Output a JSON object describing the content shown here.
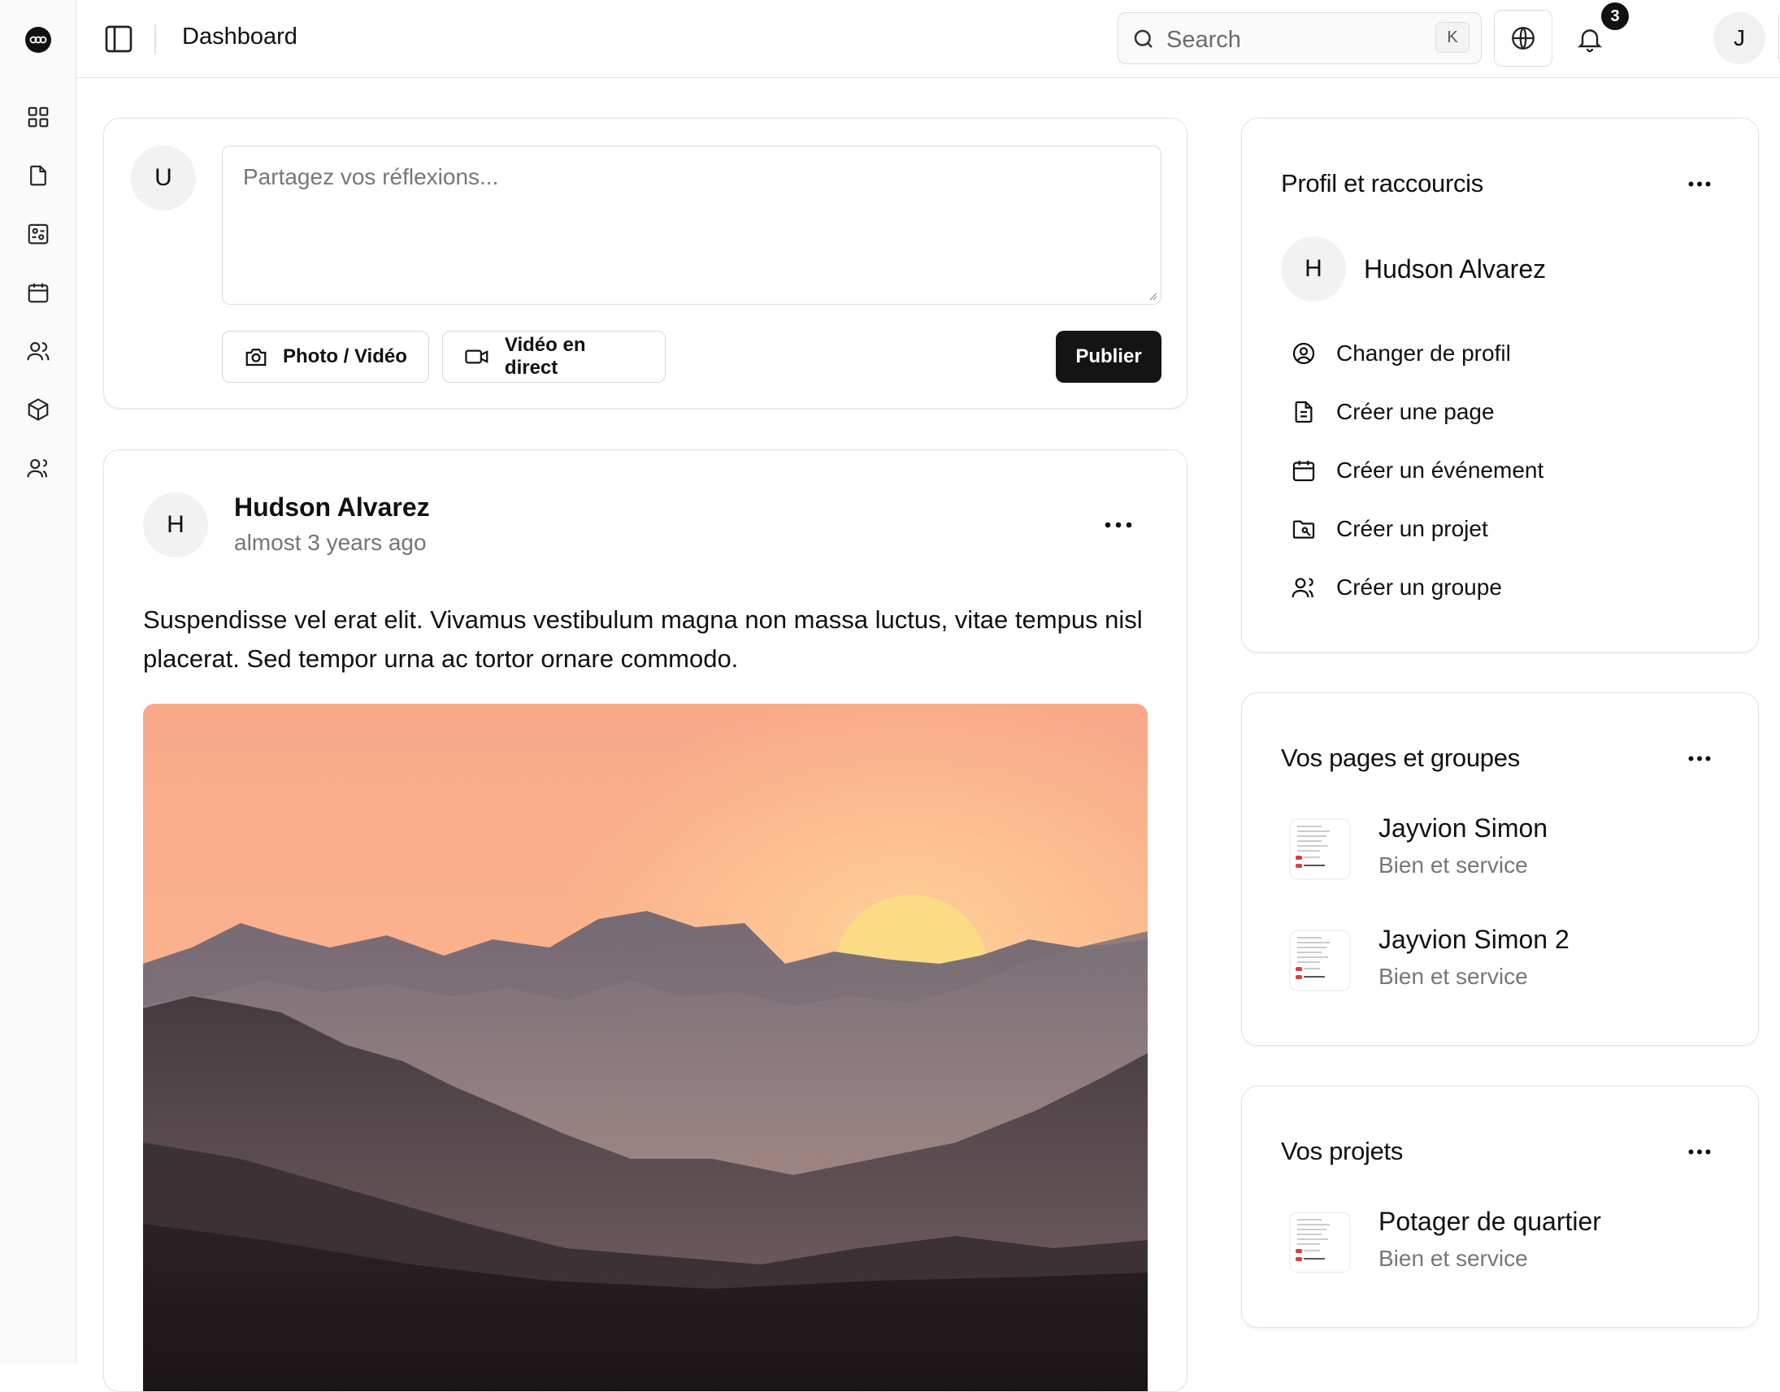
{
  "topbar": {
    "title": "Dashboard",
    "search_placeholder": "Search",
    "search_shortcut": "K",
    "notification_count": "3",
    "user_initial": "J"
  },
  "sidebar": {
    "items": [
      {
        "icon": "grid-icon"
      },
      {
        "icon": "file-icon"
      },
      {
        "icon": "kanban-icon"
      },
      {
        "icon": "calendar-icon"
      },
      {
        "icon": "users-icon"
      },
      {
        "icon": "box-icon"
      },
      {
        "icon": "group-icon"
      }
    ]
  },
  "composer": {
    "avatar_initial": "U",
    "placeholder": "Partagez vos réflexions...",
    "photo_label": "Photo / Vidéo",
    "live_label": "Vidéo en direct",
    "publish_label": "Publier"
  },
  "post": {
    "avatar_initial": "H",
    "author": "Hudson Alvarez",
    "time": "almost 3 years ago",
    "text": "Suspendisse vel erat elit. Vivamus vestibulum magna non massa luctus, vitae tempus nisl placerat. Sed tempor urna ac tortor ornare commodo."
  },
  "profile_card": {
    "title": "Profil et raccourcis",
    "avatar_initial": "H",
    "name": "Hudson Alvarez",
    "shortcuts": [
      {
        "icon": "user-circle-icon",
        "label": "Changer de profil"
      },
      {
        "icon": "document-icon",
        "label": "Créer une page"
      },
      {
        "icon": "calendar-icon",
        "label": "Créer un événement"
      },
      {
        "icon": "folder-project-icon",
        "label": "Créer un projet"
      },
      {
        "icon": "group-icon",
        "label": "Créer un groupe"
      }
    ]
  },
  "pages_card": {
    "title": "Vos pages et groupes",
    "items": [
      {
        "name": "Jayvion Simon",
        "subtitle": "Bien et service"
      },
      {
        "name": "Jayvion Simon 2",
        "subtitle": "Bien et service"
      }
    ]
  },
  "projects_card": {
    "title": "Vos projets",
    "items": [
      {
        "name": "Potager de quartier",
        "subtitle": "Bien et service"
      }
    ]
  }
}
